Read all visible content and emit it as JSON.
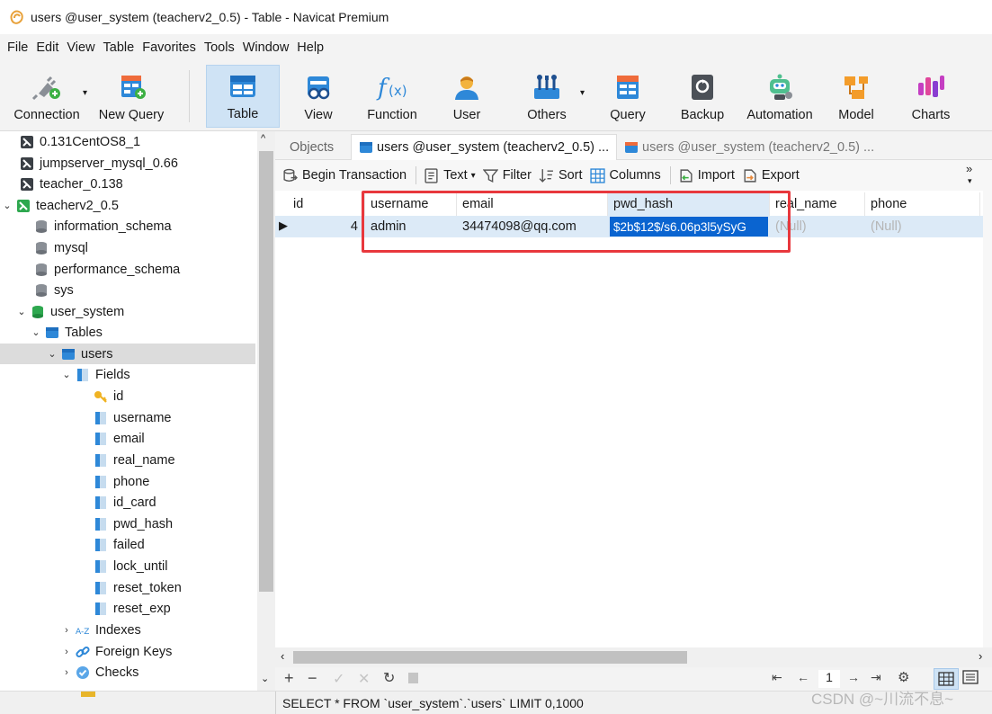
{
  "window": {
    "title": "users @user_system (teacherv2_0.5) - Table - Navicat Premium"
  },
  "menu": [
    "File",
    "Edit",
    "View",
    "Table",
    "Favorites",
    "Tools",
    "Window",
    "Help"
  ],
  "toolbar": {
    "connection": "Connection",
    "new_query": "New Query",
    "table": "Table",
    "view": "View",
    "function": "Function",
    "user": "User",
    "others": "Others",
    "query": "Query",
    "backup": "Backup",
    "automation": "Automation",
    "model": "Model",
    "charts": "Charts"
  },
  "sidebar": {
    "connections": [
      "0.131CentOS8_1",
      "jumpserver_mysql_0.66",
      "teacher_0.138",
      "teacherv2_0.5"
    ],
    "databases": [
      "information_schema",
      "mysql",
      "performance_schema",
      "sys",
      "user_system"
    ],
    "tables_label": "Tables",
    "table": "users",
    "fields_label": "Fields",
    "fields": [
      "id",
      "username",
      "email",
      "real_name",
      "phone",
      "id_card",
      "pwd_hash",
      "failed",
      "lock_until",
      "reset_token",
      "reset_exp"
    ],
    "indexes_label": "Indexes",
    "foreign_keys_label": "Foreign Keys",
    "checks_label": "Checks"
  },
  "tabs": {
    "objects": "Objects",
    "tab1": "users @user_system (teacherv2_0.5) ...",
    "tab2": "users @user_system (teacherv2_0.5) ..."
  },
  "subtoolbar": {
    "begin_transaction": "Begin Transaction",
    "text": "Text",
    "filter": "Filter",
    "sort": "Sort",
    "columns": "Columns",
    "import": "Import",
    "export": "Export"
  },
  "grid": {
    "columns": [
      "id",
      "username",
      "email",
      "pwd_hash",
      "real_name",
      "phone"
    ],
    "row": {
      "id": "4",
      "username": "admin",
      "email": "34474098@qq.com",
      "pwd_hash": "$2b$12$/s6.06p3l5ySyG",
      "real_name": "(Null)",
      "phone": "(Null)"
    }
  },
  "navbar": {
    "page": "1"
  },
  "status": {
    "sql": "SELECT * FROM `user_system`.`users` LIMIT 0,1000",
    "watermark": "CSDN @~川流不息~"
  }
}
